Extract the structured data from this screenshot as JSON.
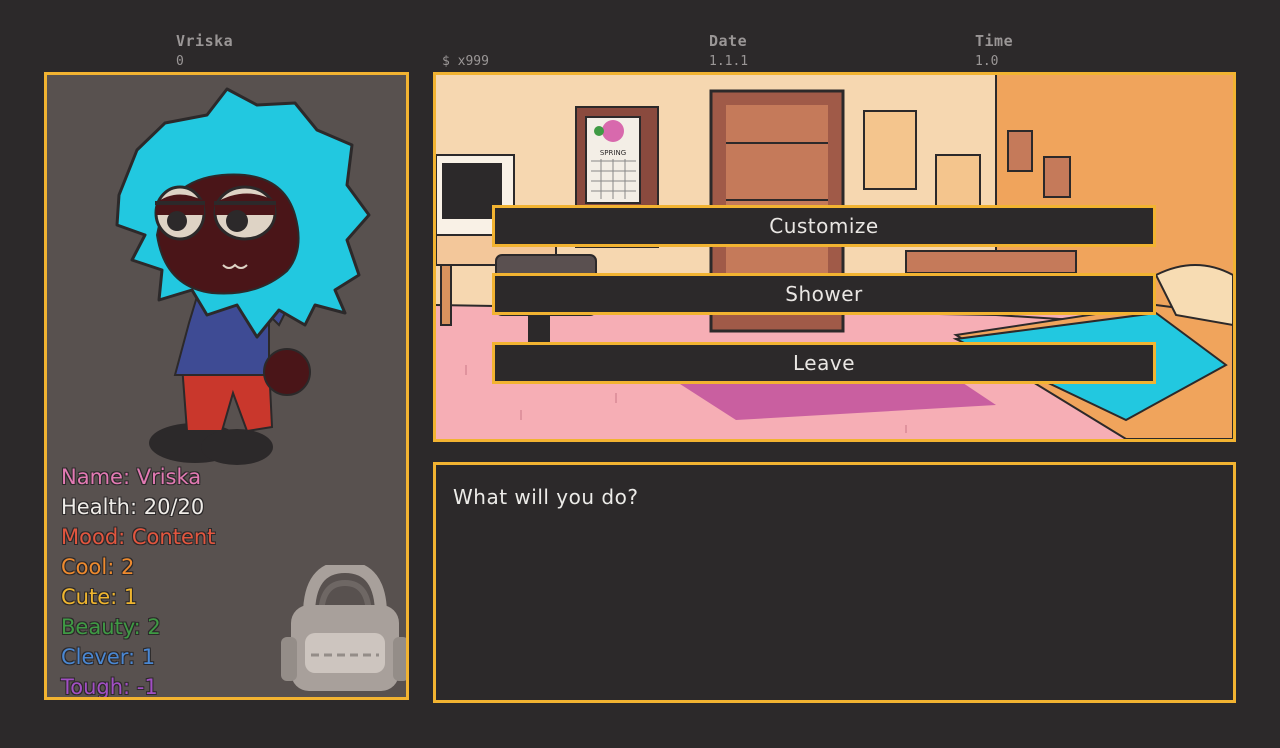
{
  "hud": {
    "player_name_label": "Vriska",
    "player_name_value": "0",
    "money": "$ x999",
    "date_label": "Date",
    "date_value": "1.1.1",
    "time_label": "Time",
    "time_value": "1.0"
  },
  "stats": [
    {
      "text": "Name: Vriska",
      "color": "#e27ab3"
    },
    {
      "text": "Health: 20/20",
      "color": "#efece8"
    },
    {
      "text": "Mood: Content",
      "color": "#e2563f"
    },
    {
      "text": "Cool: 2",
      "color": "#ee8a2e"
    },
    {
      "text": "Cute: 1",
      "color": "#efb52f"
    },
    {
      "text": "Beauty: 2",
      "color": "#3f9a44"
    },
    {
      "text": "Clever: 1",
      "color": "#4a87d2"
    },
    {
      "text": "Tough: -1",
      "color": "#a24fc4"
    }
  ],
  "actions": [
    {
      "label": "Customize"
    },
    {
      "label": "Shower"
    },
    {
      "label": "Leave"
    }
  ],
  "dialog": {
    "text": "What will you do?"
  },
  "scene": {
    "calendar_label": "SPRING"
  },
  "colors": {
    "accent": "#f2b331",
    "background": "#2c292a",
    "panel": "#58514f",
    "hair": "#22c8e0"
  }
}
